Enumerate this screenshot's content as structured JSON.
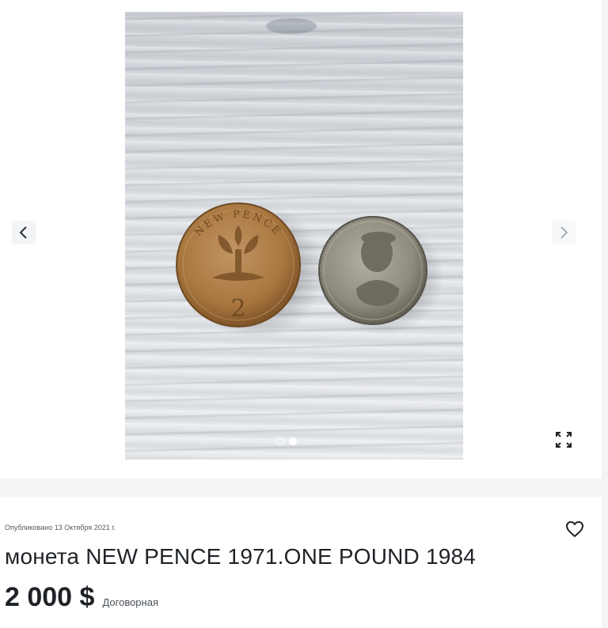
{
  "gallery": {
    "prev_icon": "chevron-left-icon",
    "next_icon": "chevron-right-icon",
    "fullscreen_icon": "expand-icon",
    "photo": {
      "coin_left_text": "NEW PENCE",
      "coin_left_value": "2"
    },
    "dots_count": 2,
    "active_dot_index": 1
  },
  "listing": {
    "published": "Опубликовано 13 Октября 2021 г.",
    "favorite_icon": "heart-icon",
    "title": "монета NEW PENCE 1971.ONE POUND 1984",
    "price": "2 000 $",
    "price_note": "Договорная"
  },
  "colors": {
    "text": "#1f2327",
    "page_background": "#f2f4f5"
  }
}
